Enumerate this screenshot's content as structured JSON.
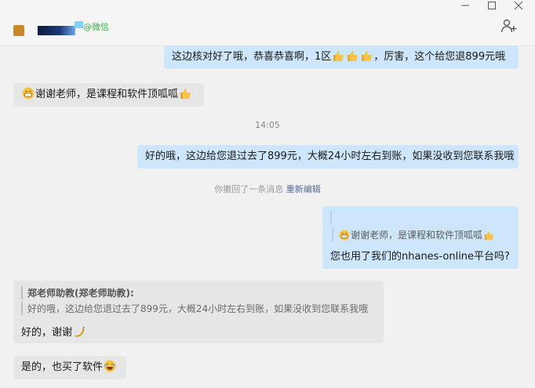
{
  "window": {
    "contact_suffix": "@微信",
    "minimize_icon": "minimize-icon",
    "maximize_icon": "maximize-icon",
    "close_icon": "close-icon",
    "add_member_icon": "add-member-icon"
  },
  "messages": [
    {
      "side": "me",
      "text_before": "这边核对好了哦，恭喜恭喜啊，1区",
      "emoji_after": "thumbs-up x3",
      "text_after": "，厉害，这个给您退899元哦"
    },
    {
      "side": "other",
      "emoji_before": "grin",
      "text": "谢谢老师，是课程和软件顶呱呱",
      "emoji_after": "thumbs-up"
    },
    {
      "type": "time",
      "text": "14:05"
    },
    {
      "side": "me",
      "text": "好的哦，这边给您退过去了899元，大概24小时左右到账，如果没收到您联系我哦"
    },
    {
      "type": "recall",
      "text": "你撤回了一条消息",
      "link": "重新编辑"
    },
    {
      "side": "me",
      "quote_header": "…",
      "quote_text": "谢谢老师，是课程和软件顶呱呱",
      "text": "您也用了我们的nhanes-online平台吗?"
    },
    {
      "side": "other",
      "quote_author": "郑老师助教(郑老师助教):",
      "quote_text": "好的哦，这边给您退过去了899元，大概24小时左右到账，如果没收到您联系我哦",
      "text": "好的，谢谢"
    },
    {
      "side": "other",
      "text": "是的，也买了软件",
      "emoji_after": "laughing"
    }
  ],
  "colors": {
    "me_bubble": "#cde6fb",
    "other_bubble": "#e6e6e6",
    "link": "#576b95",
    "wechat_green": "#3fae4a"
  }
}
